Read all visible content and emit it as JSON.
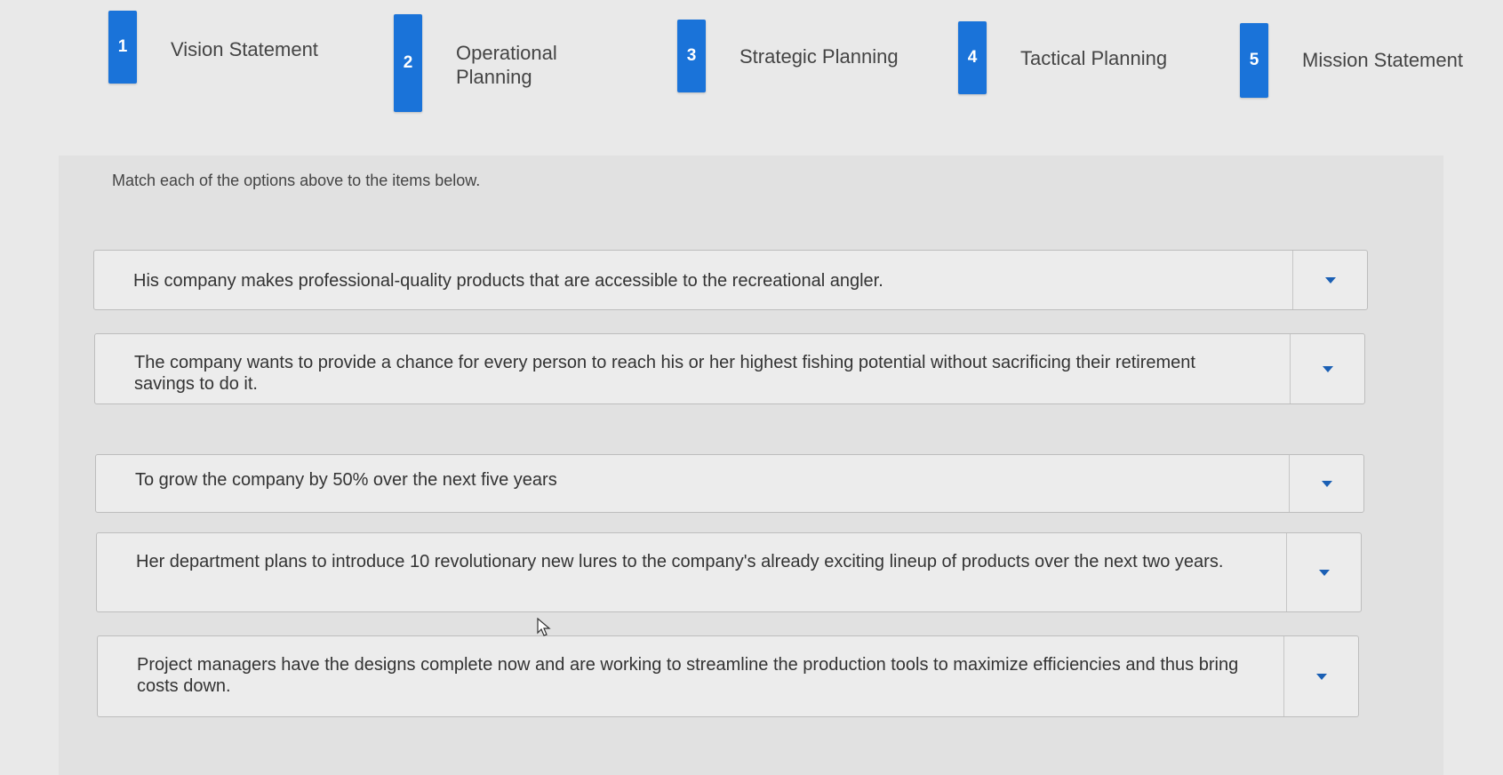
{
  "options": [
    {
      "number": "1",
      "label": "Vision Statement"
    },
    {
      "number": "2",
      "label": "Operational\nPlanning"
    },
    {
      "number": "3",
      "label": "Strategic Planning"
    },
    {
      "number": "4",
      "label": "Tactical Planning"
    },
    {
      "number": "5",
      "label": "Mission Statement"
    }
  ],
  "instructions": "Match each of the options above to the items below.",
  "items": [
    {
      "text": "His company makes professional-quality products that are accessible to the recreational angler."
    },
    {
      "text": "The company wants to provide a chance for every person to reach his or her highest fishing potential without sacrificing their retirement savings to do it."
    },
    {
      "text": "To grow the company by 50% over the next five years"
    },
    {
      "text": "Her department plans to introduce 10 revolutionary new lures to the company's already exciting lineup of products over the next two years."
    },
    {
      "text": "Project managers have the designs complete now and are working to streamline the production tools to maximize efficiencies and thus bring costs down."
    }
  ],
  "colors": {
    "badge": "#1a73d9",
    "caret": "#1a5fb4"
  }
}
